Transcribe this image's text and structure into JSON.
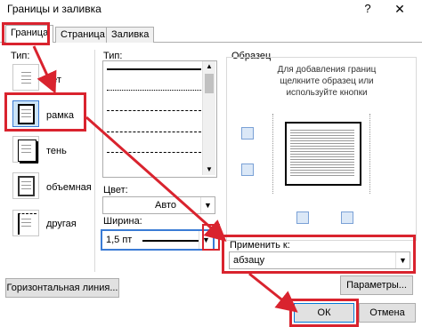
{
  "window": {
    "title": "Границы и заливка",
    "help": "?",
    "close": "✕"
  },
  "tabs": [
    {
      "label": "Граница",
      "active": true
    },
    {
      "label": "Страница",
      "active": false
    },
    {
      "label": "Заливка",
      "active": false
    }
  ],
  "settings": {
    "label": "Тип:",
    "items": [
      {
        "label": "нет"
      },
      {
        "label": "рамка",
        "selected": true
      },
      {
        "label": "тень"
      },
      {
        "label": "объемная"
      },
      {
        "label": "другая"
      }
    ]
  },
  "style": {
    "label": "Тип:"
  },
  "color": {
    "label": "Цвет:",
    "value": "Авто"
  },
  "width": {
    "label": "Ширина:",
    "value": "1,5 пт"
  },
  "preview": {
    "label": "Образец",
    "hint": "Для добавления границ щелкните образец или используйте кнопки"
  },
  "apply_to": {
    "label": "Применить к:",
    "value": "абзацу"
  },
  "buttons": {
    "options": "Параметры...",
    "horizontal_line": "Горизонтальная линия...",
    "ok": "ОК",
    "cancel": "Отмена"
  },
  "colors": {
    "highlight": "#d9232e",
    "selection": "#cce4f7"
  }
}
